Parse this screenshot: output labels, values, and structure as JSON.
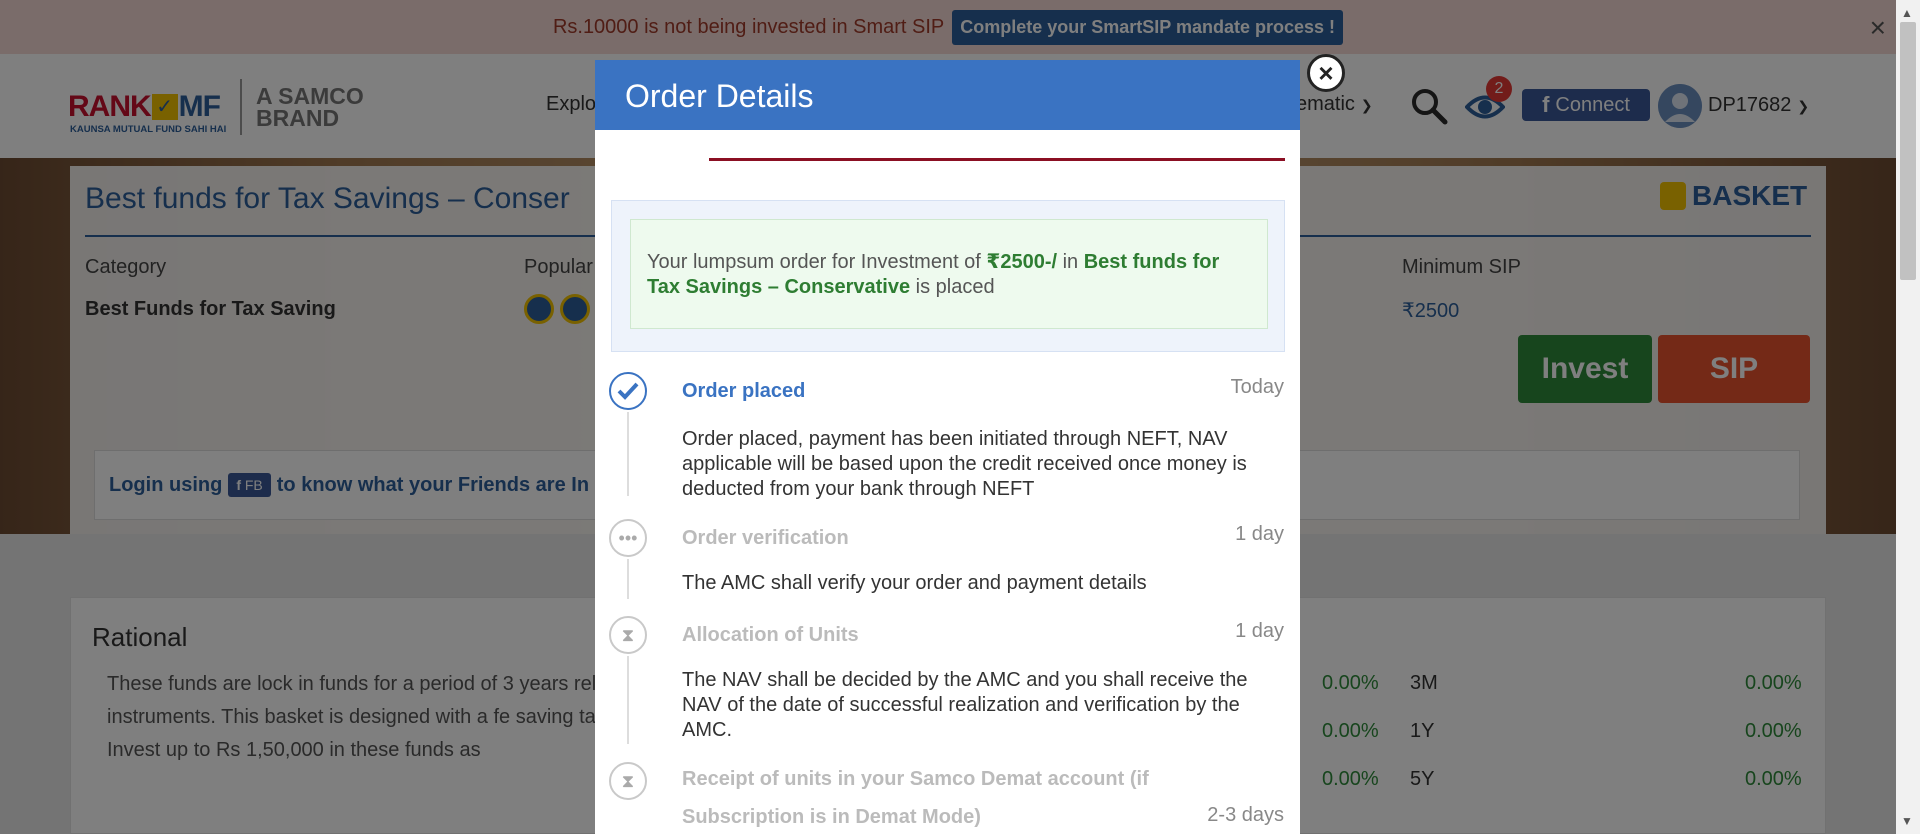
{
  "notice": {
    "text": "Rs.10000 is not being invested in Smart SIP",
    "button": "Complete your SmartSIP mandate process !",
    "close": "×"
  },
  "header": {
    "logo_rank": "RANK",
    "logo_mf": "MF",
    "logo_tagline": "KAUNSA MUTUAL FUND SAHI HAI",
    "logo_brand_line1": "A SAMCO",
    "logo_brand_line2": "BRAND",
    "nav_explore": "Explo",
    "nav_dematic": "ematic",
    "watch_count": "2",
    "connect_label": "Connect",
    "user_id": "DP17682"
  },
  "hero": {
    "title": "Best funds for Tax Savings – Conser",
    "basket_label": "BASKET",
    "category_label": "Category",
    "category_value": "Best Funds for Tax Saving",
    "popular_label": "Popular",
    "min_sip_label": "Minimum SIP",
    "min_sip_value": "₹2500",
    "invest_button": "Invest",
    "sip_button": "SIP",
    "login_prefix": "Login using",
    "login_fb": "FB",
    "login_suffix": "to know what your Friends are In"
  },
  "rational": {
    "title": "Rational",
    "text": "These funds are lock in funds for a period of 3 years related instruments. This basket is designed with a fe saving tax. Invest up to Rs 1,50,000 in these funds as",
    "returns": [
      {
        "left_value": "0.00%",
        "period": "3M",
        "value": "0.00%"
      },
      {
        "left_value": "0.00%",
        "period": "1Y",
        "value": "0.00%"
      },
      {
        "left_value": "0.00%",
        "period": "5Y",
        "value": "0.00%"
      }
    ]
  },
  "modal": {
    "title": "Order Details",
    "close": "×",
    "message": {
      "part1": "Your lumpsum order for Investment of ",
      "amount": "₹2500-/",
      "part2": " in ",
      "fund": "Best funds for Tax Savings – Conservative",
      "part3": " is placed"
    },
    "steps": [
      {
        "title": "Order placed",
        "time": "Today",
        "desc": "Order placed, payment has been initiated through NEFT, NAV applicable will be based upon the credit received once money is deducted from your bank through NEFT",
        "icon": "check-icon"
      },
      {
        "title": "Order verification",
        "time": "1 day",
        "desc": "The AMC shall verify your order and payment details",
        "icon": "dots-icon"
      },
      {
        "title": "Allocation of Units",
        "time": "1 day",
        "desc": "The NAV shall be decided by the AMC and you shall receive the NAV of the date of successful realization and verification by the AMC.",
        "icon": "hourglass-icon"
      },
      {
        "title": "Receipt of units in your Samco Demat account (if Subscription is in Demat Mode)",
        "time": "2-3 days",
        "desc": "",
        "icon": "hourglass-icon"
      }
    ]
  },
  "colors": {
    "brand_blue": "#2c5f9a",
    "modal_header": "#3a73c2",
    "invest_green": "#2e8b3a",
    "sip_orange": "#e8532e",
    "notice_bg": "#f4d9d4"
  }
}
